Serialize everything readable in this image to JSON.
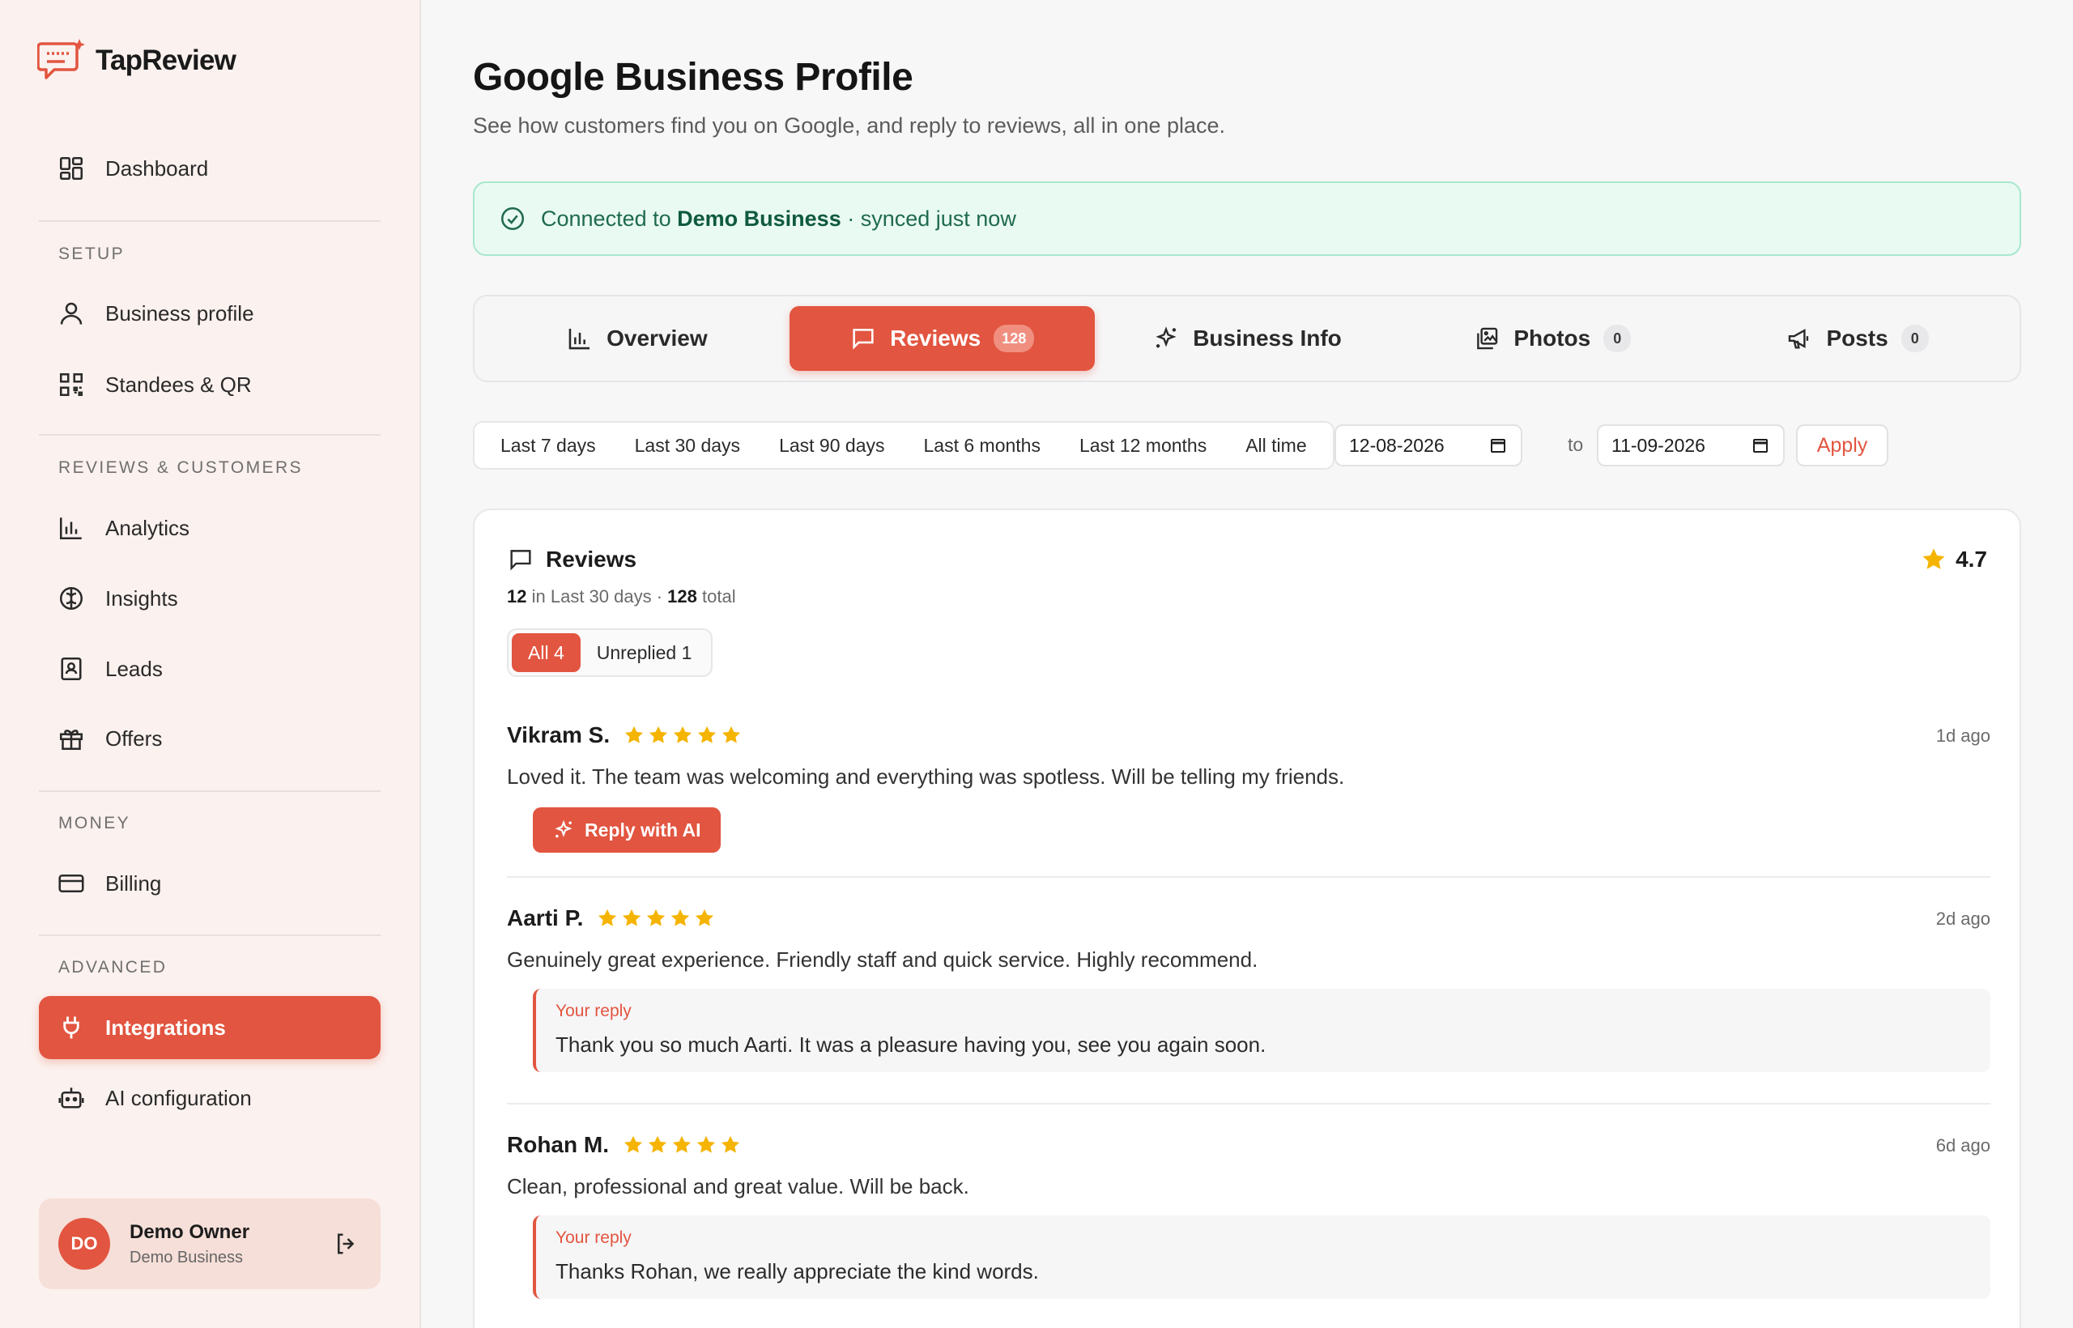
{
  "app": {
    "name": "TapReview"
  },
  "sidebar": {
    "dashboard": "Dashboard",
    "sections": {
      "setup": "SETUP",
      "reviews_customers": "REVIEWS & CUSTOMERS",
      "money": "MONEY",
      "advanced": "ADVANCED"
    },
    "items": {
      "business_profile": "Business profile",
      "standees": "Standees & QR",
      "analytics": "Analytics",
      "insights": "Insights",
      "leads": "Leads",
      "offers": "Offers",
      "billing": "Billing",
      "integrations": "Integrations",
      "ai_config": "AI configuration"
    },
    "user": {
      "initials": "DO",
      "name": "Demo Owner",
      "business": "Demo Business"
    }
  },
  "page": {
    "title": "Google Business Profile",
    "subtitle": "See how customers find you on Google, and reply to reviews, all in one place."
  },
  "banner": {
    "prefix": "Connected to",
    "business": "Demo Business",
    "suffix": "· synced just now"
  },
  "tabs": {
    "overview": "Overview",
    "reviews": "Reviews",
    "reviews_count": "128",
    "business_info": "Business Info",
    "photos": "Photos",
    "photos_count": "0",
    "posts": "Posts",
    "posts_count": "0"
  },
  "ranges": [
    "Last 7 days",
    "Last 30 days",
    "Last 90 days",
    "Last 6 months",
    "Last 12 months",
    "All time"
  ],
  "dates": {
    "from": "12-08-2026",
    "to_label": "to",
    "to": "11-09-2026",
    "apply": "Apply"
  },
  "reviews_card": {
    "title": "Reviews",
    "rating": "4.7",
    "stats": {
      "recent_count": "12",
      "recent_label": "in Last 30 days ·",
      "total_count": "128",
      "total_label": "total"
    },
    "filters": {
      "all": "All 4",
      "unreplied": "Unreplied 1"
    },
    "list": [
      {
        "name": "Vikram S.",
        "time": "1d ago",
        "text": "Loved it. The team was welcoming and everything was spotless. Will be telling my friends.",
        "action": "Reply with AI"
      },
      {
        "name": "Aarti P.",
        "time": "2d ago",
        "text": "Genuinely great experience. Friendly staff and quick service. Highly recommend.",
        "reply_label": "Your reply",
        "reply": "Thank you so much Aarti. It was a pleasure having you, see you again soon."
      },
      {
        "name": "Rohan M.",
        "time": "6d ago",
        "text": "Clean, professional and great value. Will be back.",
        "reply_label": "Your reply",
        "reply": "Thanks Rohan, we really appreciate the kind words."
      }
    ]
  },
  "colors": {
    "accent": "#e25540",
    "star": "#f5b400",
    "success_bg": "#e9faf3",
    "success_border": "#a8e8cd",
    "sidebar_bg": "#fbf1ee"
  }
}
